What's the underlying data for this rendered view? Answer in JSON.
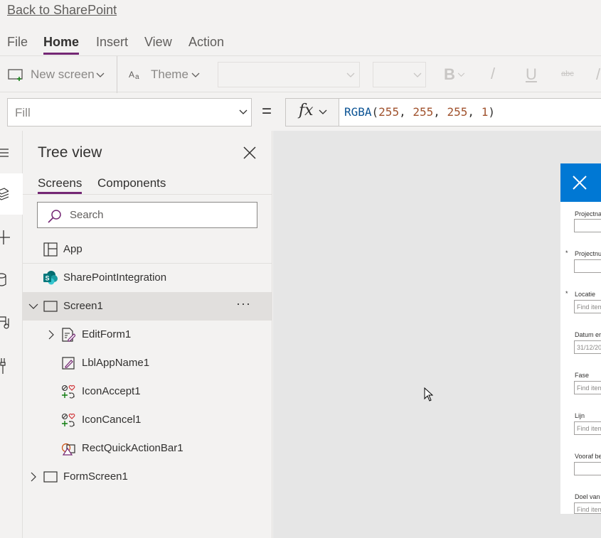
{
  "header": {
    "back_link": "Back to SharePoint"
  },
  "menu": {
    "items": [
      {
        "label": "File"
      },
      {
        "label": "Home"
      },
      {
        "label": "Insert"
      },
      {
        "label": "View"
      },
      {
        "label": "Action"
      }
    ],
    "active": "Home"
  },
  "toolbar": {
    "new_screen": "New screen",
    "theme": "Theme",
    "bold_glyph": "B",
    "italic_glyph": "/",
    "underline_glyph": "U",
    "strike_glyph": "abc"
  },
  "formula_bar": {
    "property": "Fill",
    "equals": "=",
    "fx": "fx",
    "formula": {
      "fn": "RGBA",
      "open": "(",
      "r": "255",
      "g": "255",
      "b": "255",
      "a": "1",
      "sep": ", ",
      "close": ")"
    }
  },
  "tree_view": {
    "title": "Tree view",
    "tabs": [
      {
        "label": "Screens"
      },
      {
        "label": "Components"
      }
    ],
    "search_placeholder": "Search",
    "items": [
      {
        "label": "App",
        "icon": "app-icon"
      },
      {
        "label": "SharePointIntegration",
        "icon": "sharepoint-icon"
      },
      {
        "label": "Screen1",
        "icon": "screen-icon",
        "expanded": true,
        "selected": true,
        "more": "···"
      },
      {
        "label": "EditForm1",
        "icon": "edit-form-icon",
        "expandable": true
      },
      {
        "label": "LblAppName1",
        "icon": "label-icon"
      },
      {
        "label": "IconAccept1",
        "icon": "icons-icon"
      },
      {
        "label": "IconCancel1",
        "icon": "icons-icon"
      },
      {
        "label": "RectQuickActionBar1",
        "icon": "shapes-icon"
      },
      {
        "label": "FormScreen1",
        "icon": "screen-icon",
        "expandable": true
      }
    ]
  },
  "canvas": {
    "form": {
      "fields": [
        {
          "label": "Projectna",
          "required": false,
          "value": ""
        },
        {
          "label": "Projectnu",
          "required": true,
          "value": ""
        },
        {
          "label": "Locatie",
          "required": true,
          "value": "Find item"
        },
        {
          "label": "Datum er",
          "required": false,
          "value": "31/12/20"
        },
        {
          "label": "Fase",
          "required": false,
          "value": "Find item"
        },
        {
          "label": "Lijn",
          "required": false,
          "value": "Find item"
        },
        {
          "label": "Vooraf be",
          "required": false,
          "value": ""
        },
        {
          "label": "Doel van",
          "required": false,
          "value": "Find item"
        }
      ],
      "required_mark": "*"
    }
  },
  "colors": {
    "accent": "#742774",
    "header_blue": "#0078d4",
    "canvas_bg": "#e6e6e6",
    "panel_bg": "#f3f2f1"
  }
}
